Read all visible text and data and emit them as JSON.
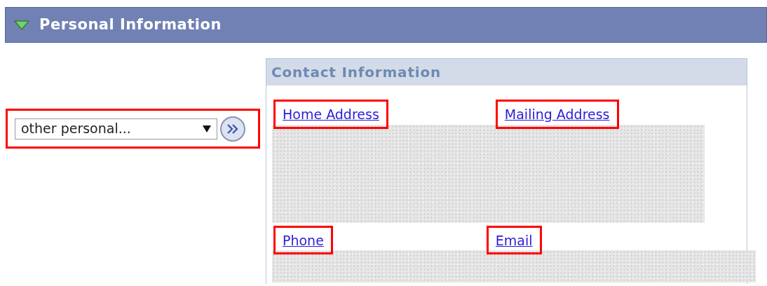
{
  "section": {
    "title": "Personal Information",
    "expanded": true
  },
  "selector": {
    "value": "other personal...",
    "highlighted": true
  },
  "contact_panel": {
    "title": "Contact Information",
    "rows": [
      {
        "links": [
          {
            "label": "Home Address",
            "highlighted": true
          },
          {
            "label": "Mailing Address",
            "highlighted": true
          }
        ]
      },
      {
        "links": [
          {
            "label": "Phone",
            "highlighted": true
          },
          {
            "label": "Email",
            "highlighted": true
          }
        ]
      }
    ]
  }
}
